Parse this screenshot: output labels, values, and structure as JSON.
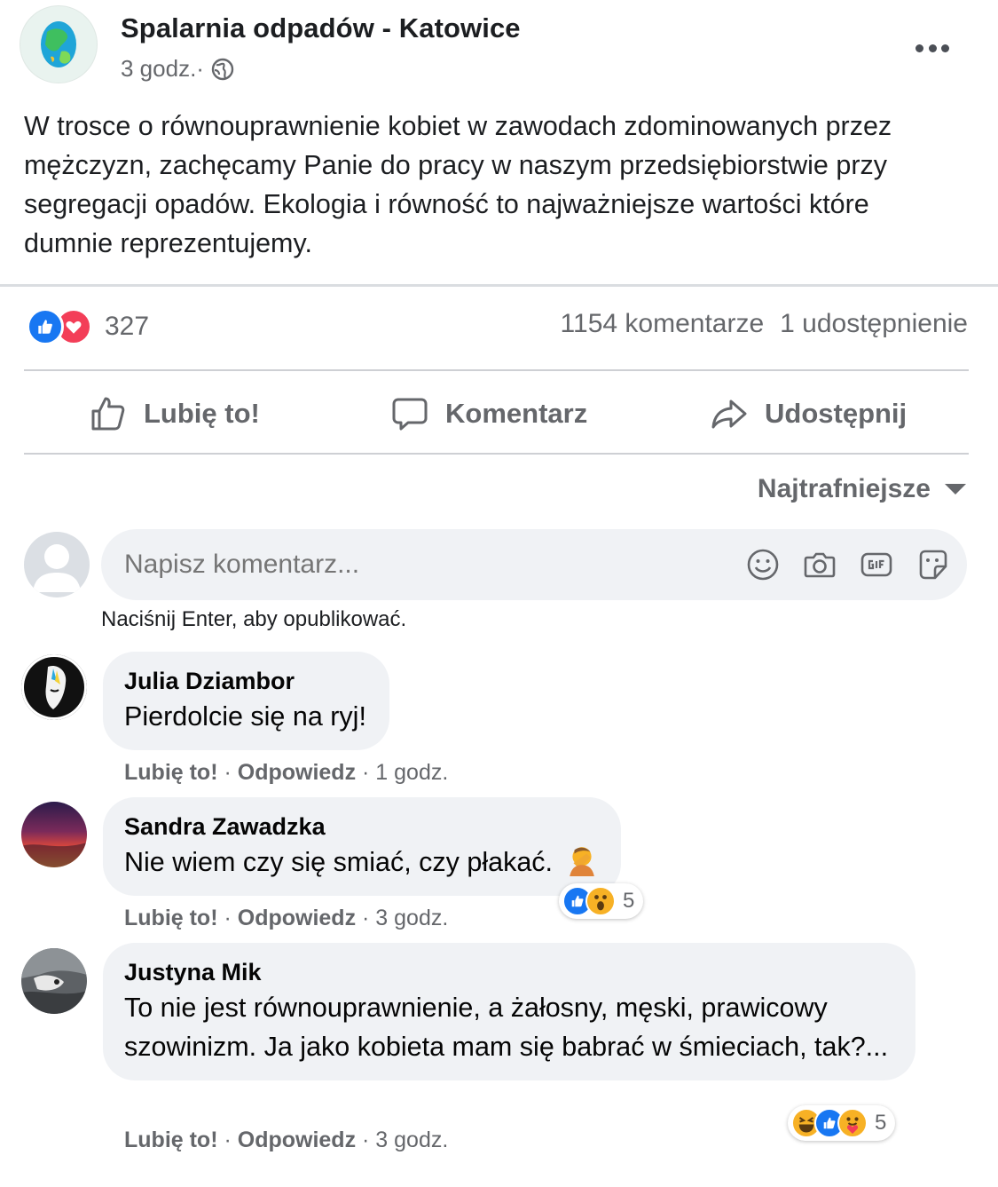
{
  "post": {
    "page_name": "Spalarnia odpadów - Katowice",
    "time": "3 godz.",
    "separator": " · ",
    "text": "W trosce o równouprawnienie kobiet w zawodach zdominowanych przez mężczyzn, zachęcamy Panie do pracy w naszym przedsiębiorstwie przy segregacji opadów. Ekologia i równość to najważniejsze wartości które dumnie reprezentujemy.",
    "reaction_count": "327",
    "comments_count": "1154 komentarze",
    "shares_count": "1 udostępnienie",
    "reaction_icons": [
      "like-icon",
      "love-icon"
    ]
  },
  "actions": {
    "like": "Lubię to!",
    "comment": "Komentarz",
    "share": "Udostępnij"
  },
  "sort": {
    "label": "Najtrafniejsze"
  },
  "composer": {
    "placeholder": "Napisz komentarz...",
    "hint": "Naciśnij Enter, aby opublikować.",
    "icons": [
      "emoji-icon",
      "camera-icon",
      "gif-icon",
      "sticker-icon"
    ]
  },
  "comments": [
    {
      "author": "Julia Dziambor",
      "text": "Pierdolcie się na ryj!",
      "like": "Lubię to!",
      "reply": "Odpowiedz",
      "time": "1 godz."
    },
    {
      "author": "Sandra Zawadzka",
      "text": "Nie wiem czy się smiać, czy płakać.",
      "like": "Lubię to!",
      "reply": "Odpowiedz",
      "time": "3 godz.",
      "reactions": [
        "like-icon",
        "wow-icon"
      ],
      "reaction_count": "5"
    },
    {
      "author": "Justyna Mik",
      "text": "To nie jest równouprawnienie, a żałosny, męski, prawicowy szowinizm. Ja jako kobieta mam się babrać w śmieciach, tak?...",
      "like": "Lubię to!",
      "reply": "Odpowiedz",
      "time": "3 godz.",
      "reactions": [
        "haha-icon",
        "like-icon",
        "care-icon"
      ],
      "reaction_count": "5"
    }
  ],
  "colors": {
    "accent": "#1877f2",
    "love": "#f33e58",
    "secondary_text": "#65676b",
    "bubble": "#f0f2f5"
  }
}
